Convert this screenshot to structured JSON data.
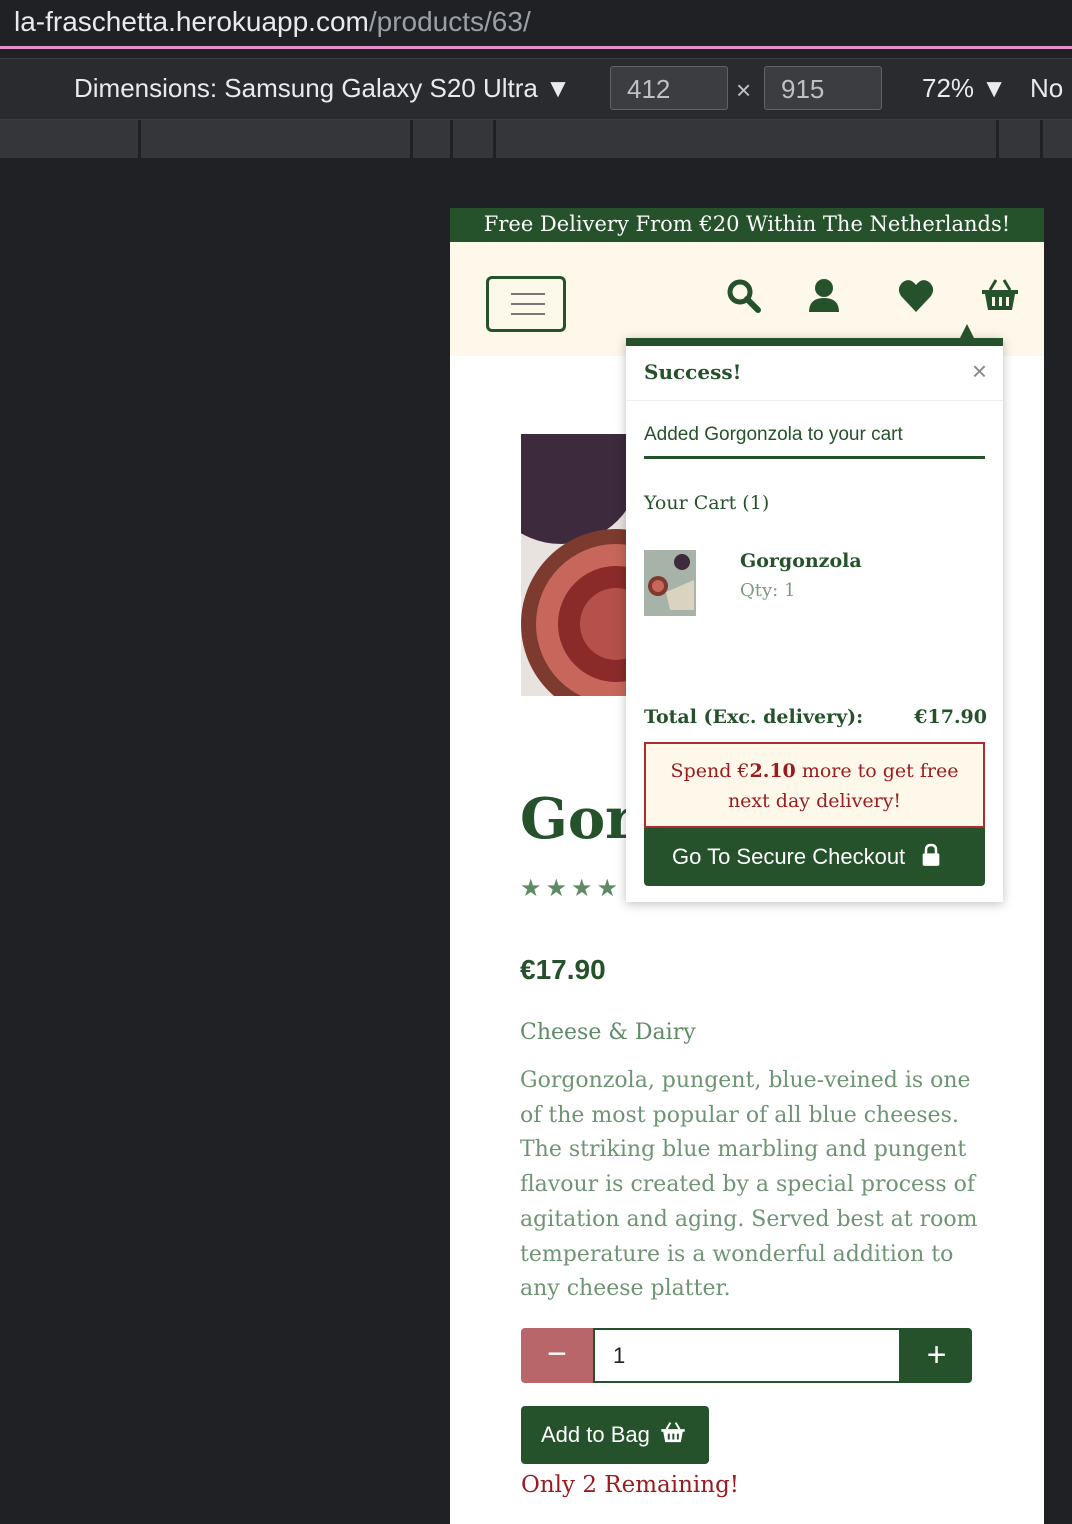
{
  "browser": {
    "url_host": "la-fraschetta.herokuapp.com",
    "url_path": "/products/63/"
  },
  "devtools": {
    "dimensions_label": "Dimensions: Samsung Galaxy S20 Ultra",
    "width_value": "412",
    "times": "×",
    "height_value": "915",
    "zoom": "72%",
    "throttle": "No"
  },
  "site": {
    "banner": "Free Delivery From €20 Within The Netherlands!",
    "brand_color": "#25522b",
    "header_bg": "#fdf8e9"
  },
  "product": {
    "title": "Gorgonzola",
    "stars": "★★★★",
    "price": "€17.90",
    "category": "Cheese & Dairy",
    "description": "Gorgonzola, pungent, blue-veined is one of the most popular of all blue cheeses. The striking blue marbling and pungent flavour is created by a special process of agitation and aging. Served best at room temperature is a wonderful addition to any cheese platter.",
    "qty_minus": "−",
    "qty_value": "1",
    "qty_plus": "+",
    "add_to_bag": "Add to Bag",
    "remaining": "Only 2 Remaining!"
  },
  "toast": {
    "title": "Success!",
    "close": "×",
    "message": "Added Gorgonzola to your cart",
    "cart_heading": "Your Cart (1)",
    "item_name": "Gorgonzola",
    "item_qty": "Qty: 1",
    "total_label": "Total (Exc. delivery):",
    "total_value": "€17.90",
    "spend_pre": "Spend €",
    "spend_amount": "2.10",
    "spend_post": " more to get free",
    "spend_line2": "next day delivery!",
    "checkout": "Go To Secure Checkout"
  }
}
